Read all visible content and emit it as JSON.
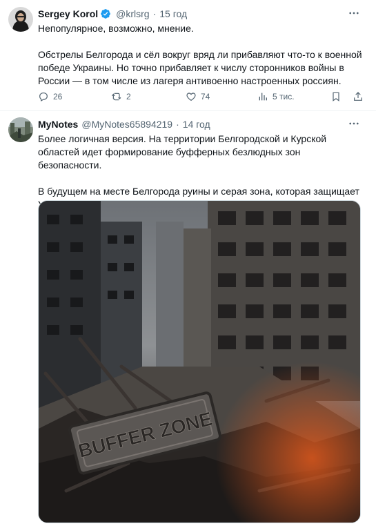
{
  "tweet1": {
    "author_name": "Sergey Korol",
    "handle": "@krlsrg",
    "separator": "·",
    "time": "15 год",
    "text_line1": "Непопулярное, возможно, мнение.",
    "text_para2": "Обстрелы Белгорода и сёл вокруг вряд ли прибавляют что-то к военной победе Украины. Но точно прибавляет к числу сторонников войны в России — в том числе из лагеря антивоенно настроенных россиян.",
    "replies": "26",
    "reposts": "2",
    "likes": "74",
    "views": "5 тис.",
    "icons": [
      "verified-badge-icon",
      "more-icon",
      "reply-icon",
      "repost-icon",
      "like-icon",
      "views-icon",
      "bookmark-icon",
      "share-icon"
    ]
  },
  "tweet2": {
    "author_name": "MyNotes",
    "handle": "@MyNotes65894219",
    "separator": "·",
    "time": "14 год",
    "text_para1": "Более логичная версия. На территории Белгородской и Курской областей идет формирование буфферных безлюдных зон безопасности.",
    "text_para2": "В будущем на месте Белгорода руины и серая зона, которая защищает Украину.",
    "image": {
      "sign_text": "BUFFER ZONE"
    }
  },
  "colors": {
    "text": "#0f1419",
    "muted": "#536471",
    "verified": "#1d9bf0",
    "divider": "#eff3f4"
  }
}
